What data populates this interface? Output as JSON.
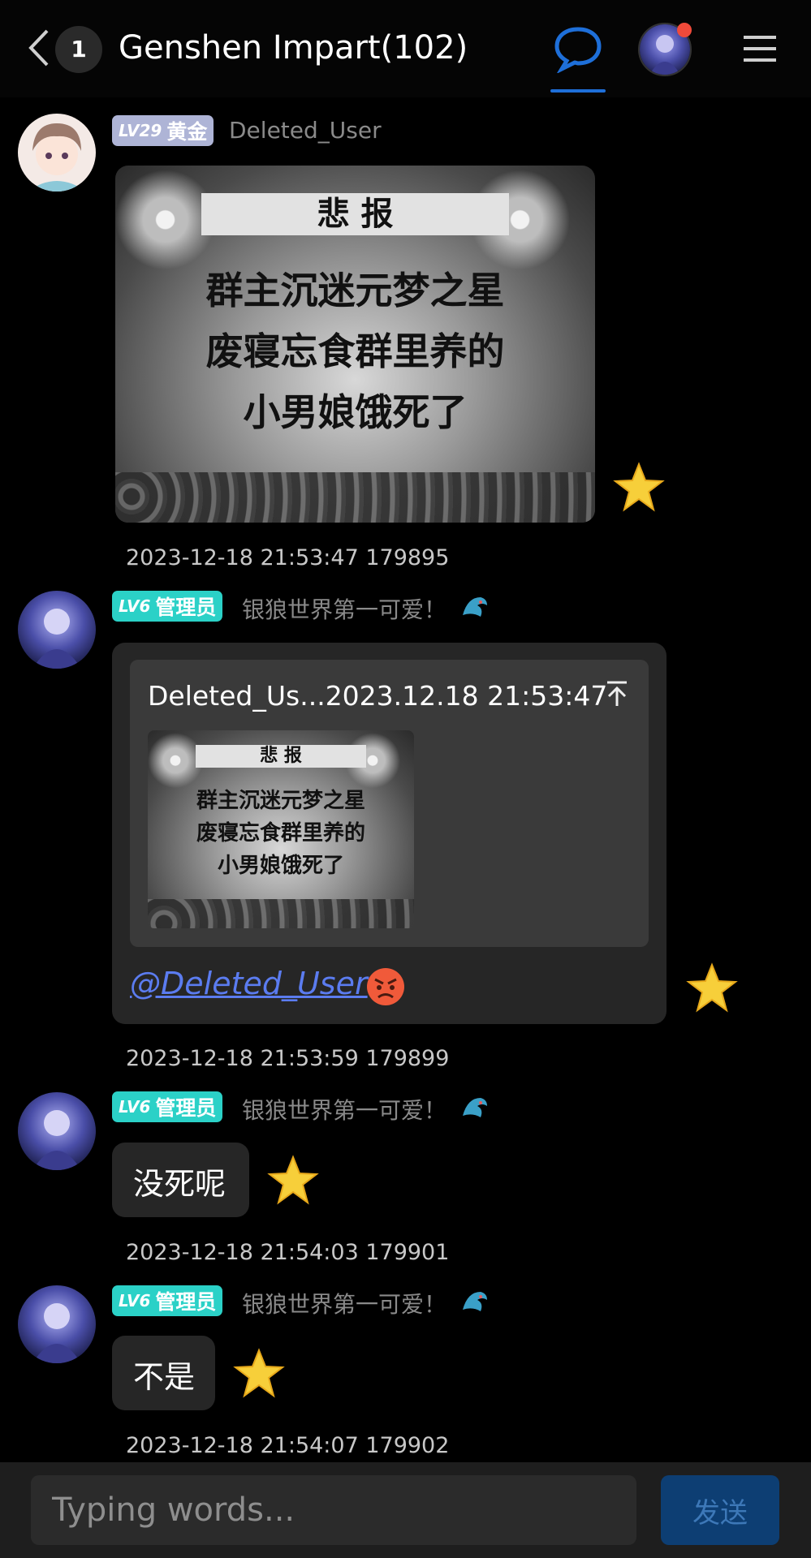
{
  "header": {
    "unread_count": "1",
    "title": "Genshen Impart(102)",
    "back_icon": "chevron-left-icon",
    "chat_icon": "chat-bubble-icon",
    "menu_icon": "hamburger-menu-icon",
    "accent": "#1e6fd9",
    "notification_color": "#f04a3a"
  },
  "messages": [
    {
      "level_code": "LV29",
      "level_title": "黄金",
      "username": "Deleted_User",
      "meme": {
        "title": "悲  报",
        "lines": [
          "群主沉迷元梦之星",
          "废寝忘食群里养的",
          "小男娘饿死了"
        ]
      },
      "timestamp": "2023-12-18 21:53:47 179895"
    },
    {
      "level_code": "LV6",
      "level_title": "管理员",
      "username": "银狼世界第一可爱！",
      "quote": {
        "header": "Deleted_Us...2023.12.18 21:53:47",
        "meme": {
          "title": "悲  报",
          "lines": [
            "群主沉迷元梦之星",
            "废寝忘食群里养的",
            "小男娘饿死了"
          ]
        }
      },
      "mention": "@Deleted_User",
      "timestamp": "2023-12-18 21:53:59 179899"
    },
    {
      "level_code": "LV6",
      "level_title": "管理员",
      "username": "银狼世界第一可爱！",
      "text": "没死呢",
      "timestamp": "2023-12-18 21:54:03 179901"
    },
    {
      "level_code": "LV6",
      "level_title": "管理员",
      "username": "银狼世界第一可爱！",
      "text": "不是",
      "timestamp": "2023-12-18 21:54:07 179902"
    }
  ],
  "input": {
    "placeholder": "Typing words...",
    "send_label": "发送"
  }
}
